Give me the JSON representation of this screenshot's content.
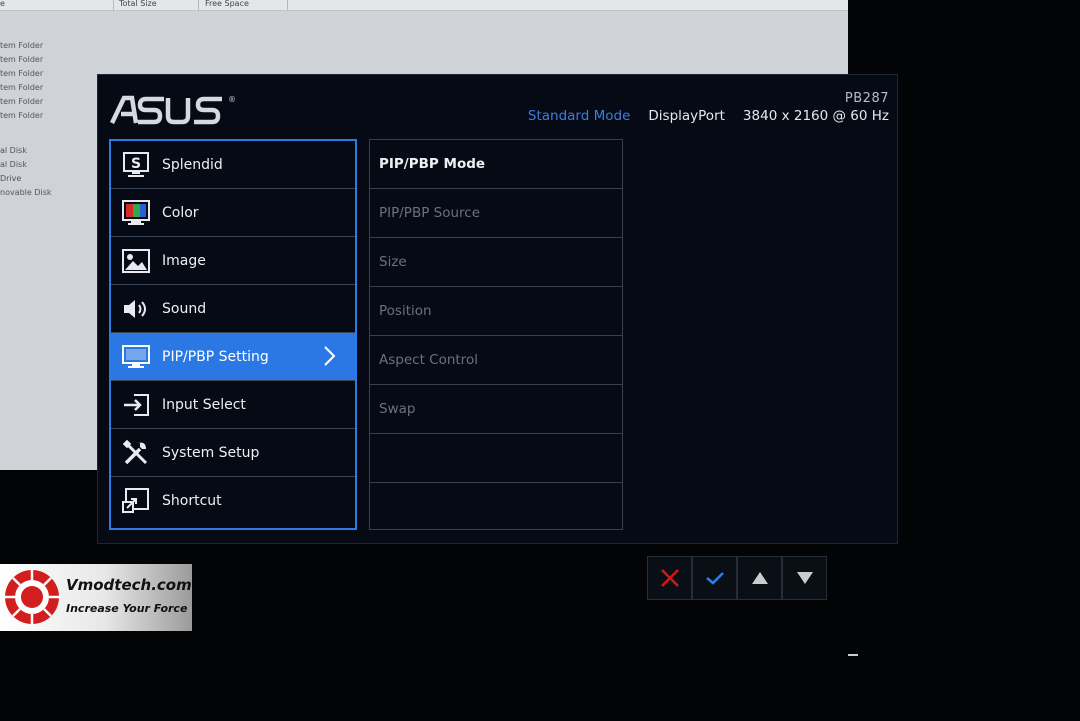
{
  "background_window": {
    "columns": [
      "Total Size",
      "Free Space"
    ],
    "rows": [
      "tem Folder",
      "tem Folder",
      "tem Folder",
      "tem Folder",
      "tem Folder",
      "tem Folder",
      "al Disk",
      "al Disk",
      "Drive",
      "novable Disk"
    ]
  },
  "osd": {
    "brand": "ASUS",
    "model": "PB287",
    "status": {
      "mode": "Standard Mode",
      "input": "DisplayPort",
      "resolution": "3840 x 2160 @ 60 Hz"
    },
    "main_menu": [
      {
        "label": "Splendid",
        "icon": "splendid-icon"
      },
      {
        "label": "Color",
        "icon": "color-icon"
      },
      {
        "label": "Image",
        "icon": "image-icon"
      },
      {
        "label": "Sound",
        "icon": "speaker-icon"
      },
      {
        "label": "PIP/PBP Setting",
        "icon": "monitor-icon",
        "selected": true
      },
      {
        "label": "Input Select",
        "icon": "input-icon"
      },
      {
        "label": "System Setup",
        "icon": "tools-icon"
      },
      {
        "label": "Shortcut",
        "icon": "shortcut-icon"
      }
    ],
    "sub_menu": [
      {
        "label": "PIP/PBP Mode",
        "enabled": true
      },
      {
        "label": "PIP/PBP Source",
        "enabled": false
      },
      {
        "label": "Size",
        "enabled": false
      },
      {
        "label": "Position",
        "enabled": false
      },
      {
        "label": "Aspect Control",
        "enabled": false
      },
      {
        "label": "Swap",
        "enabled": false
      },
      {
        "label": "",
        "enabled": false
      },
      {
        "label": "",
        "enabled": false
      }
    ],
    "accent_color": "#2b78e4"
  },
  "controls": [
    {
      "name": "close-icon",
      "color": "#d2161c"
    },
    {
      "name": "check-icon",
      "color": "#2f7de8"
    },
    {
      "name": "up-arrow-icon",
      "color": "#c8ccd2"
    },
    {
      "name": "down-arrow-icon",
      "color": "#c8ccd2"
    }
  ],
  "watermark": {
    "site": "Vmodtech.com",
    "tagline": "Increase Your Force"
  }
}
